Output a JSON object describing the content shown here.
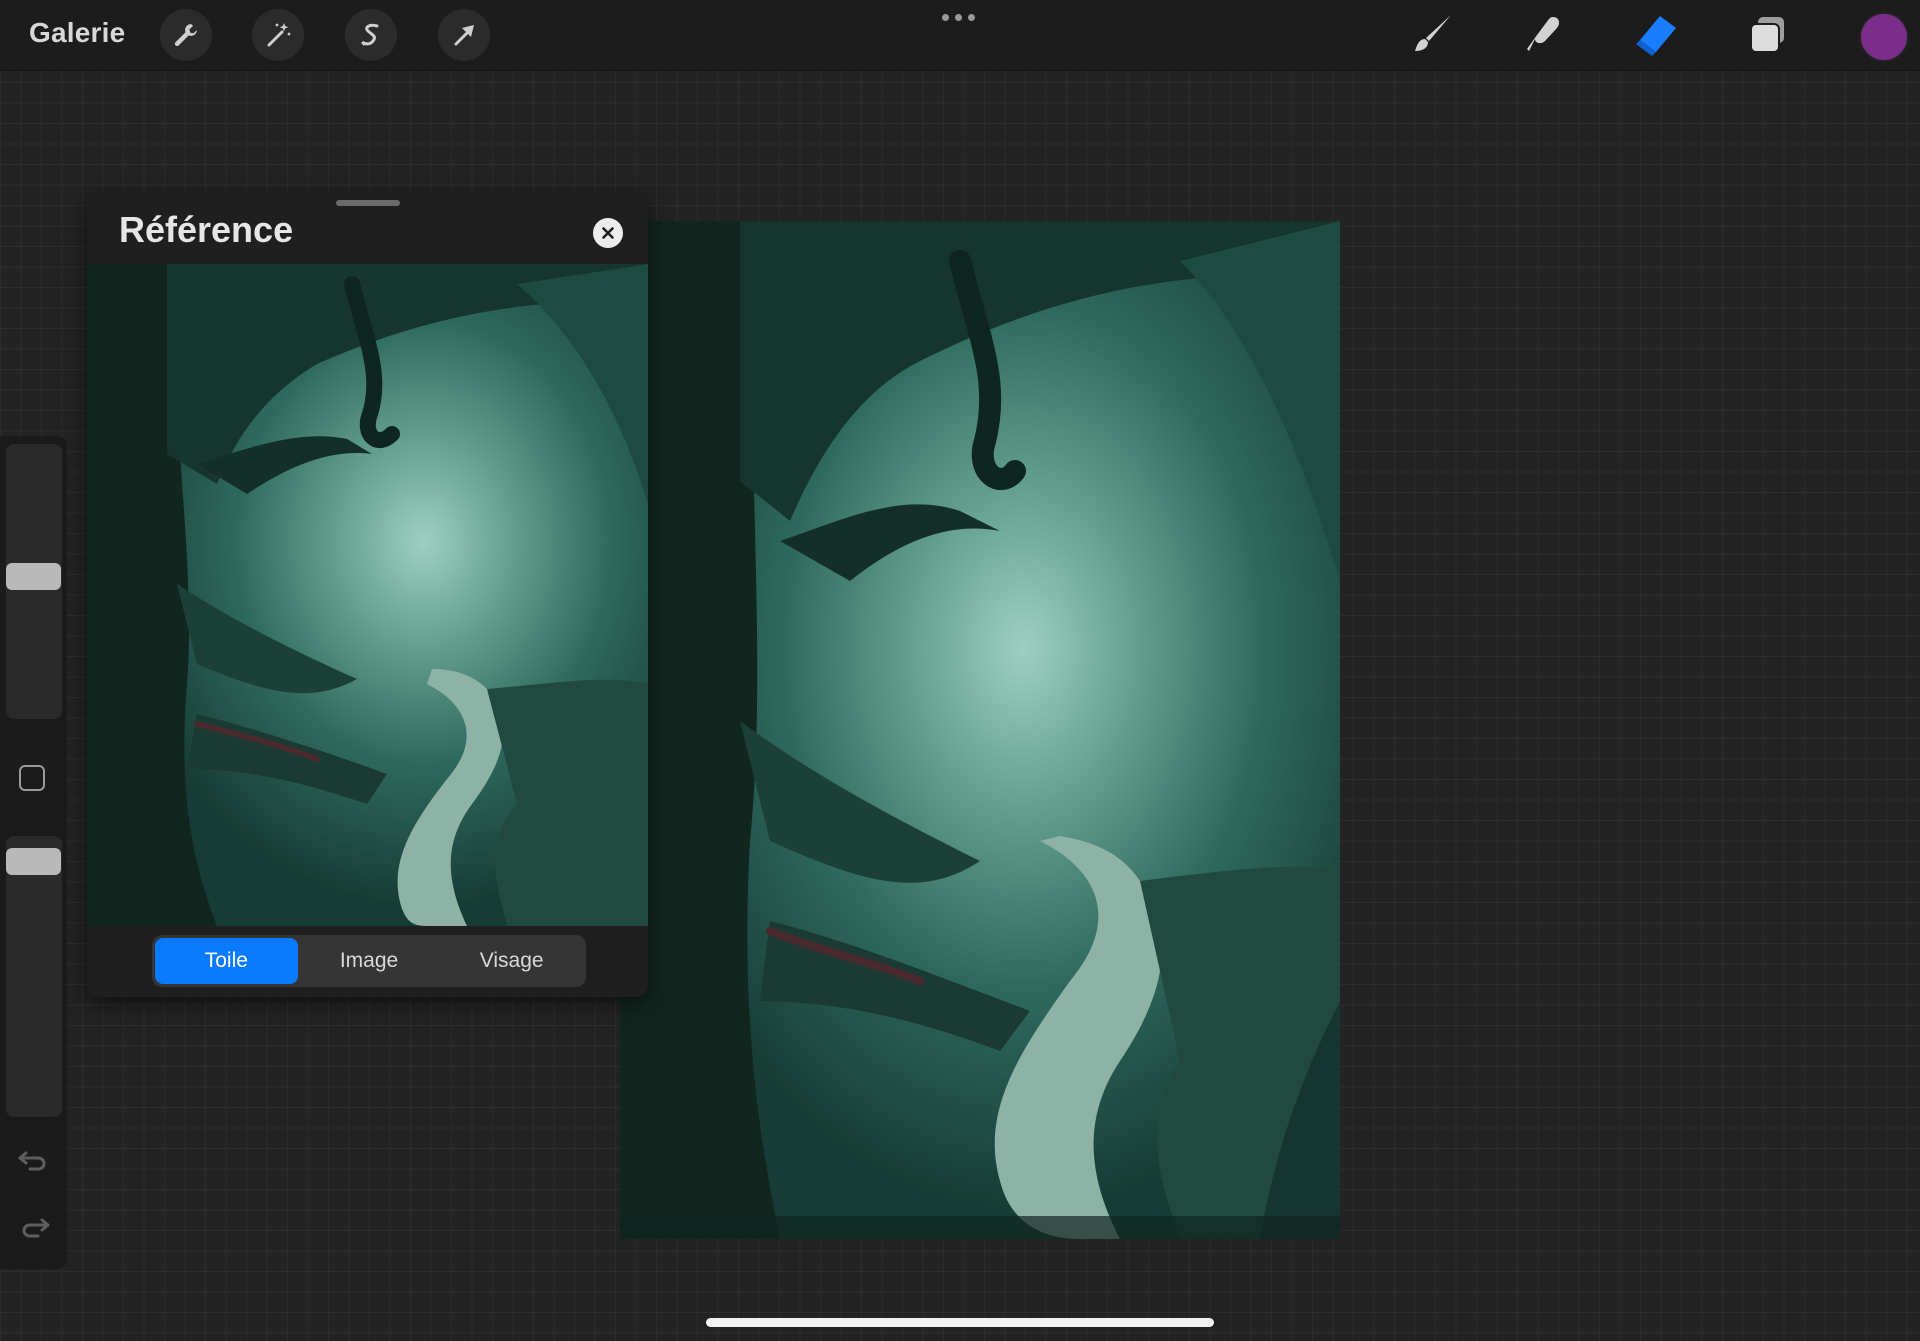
{
  "topbar": {
    "gallery_label": "Galerie",
    "left_tools": [
      "wrench-icon",
      "magic-wand-icon",
      "selection-s-icon",
      "transform-arrow-icon"
    ],
    "right_tools": [
      "brush-icon",
      "smudge-icon",
      "eraser-icon",
      "layers-icon"
    ],
    "active_tool": "eraser",
    "active_tool_color": "#1a7cff",
    "current_color": "#7a2e8a"
  },
  "sidebar": {
    "brush_size_level": 0.48,
    "opacity_level": 0.1,
    "items": [
      "brush-size-slider",
      "modify-button",
      "opacity-slider",
      "undo-icon",
      "redo-icon"
    ]
  },
  "reference": {
    "title": "Référence",
    "tabs": [
      {
        "label": "Toile",
        "active": true
      },
      {
        "label": "Image",
        "active": false
      },
      {
        "label": "Visage",
        "active": false
      }
    ]
  },
  "canvas": {
    "subject": "forest-path-painting"
  }
}
